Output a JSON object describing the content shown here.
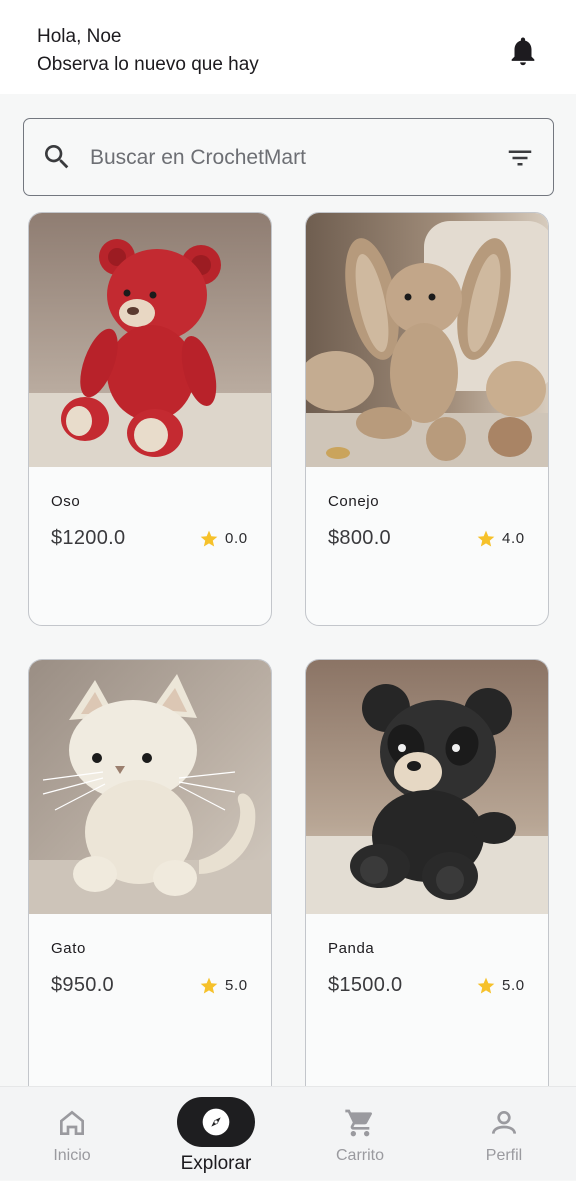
{
  "header": {
    "greeting": "Hola, Noe",
    "subtitle": "Observa lo nuevo que hay",
    "notification_icon": "bell-icon"
  },
  "search": {
    "placeholder": "Buscar en CrochetMart",
    "value": "",
    "search_icon": "search-icon",
    "filter_icon": "filter-icon"
  },
  "products": [
    {
      "name": "Oso",
      "price": "$1200.0",
      "rating": "0.0",
      "image": "red crochet teddy bear"
    },
    {
      "name": "Conejo",
      "price": "$800.0",
      "rating": "4.0",
      "image": "beige crochet bunny"
    },
    {
      "name": "Gato",
      "price": "$950.0",
      "rating": "5.0",
      "image": "white crochet cat"
    },
    {
      "name": "Panda",
      "price": "$1500.0",
      "rating": "5.0",
      "image": "black crochet panda"
    }
  ],
  "bottom_nav": [
    {
      "label": "Inicio",
      "icon": "home-icon",
      "active": false
    },
    {
      "label": "Explorar",
      "icon": "compass-icon",
      "active": true
    },
    {
      "label": "Carrito",
      "icon": "cart-icon",
      "active": false
    },
    {
      "label": "Perfil",
      "icon": "person-icon",
      "active": false
    }
  ],
  "colors": {
    "star": "#f6c12a",
    "active_pill": "#1e1e20",
    "inactive_label": "#9a9a9f"
  }
}
